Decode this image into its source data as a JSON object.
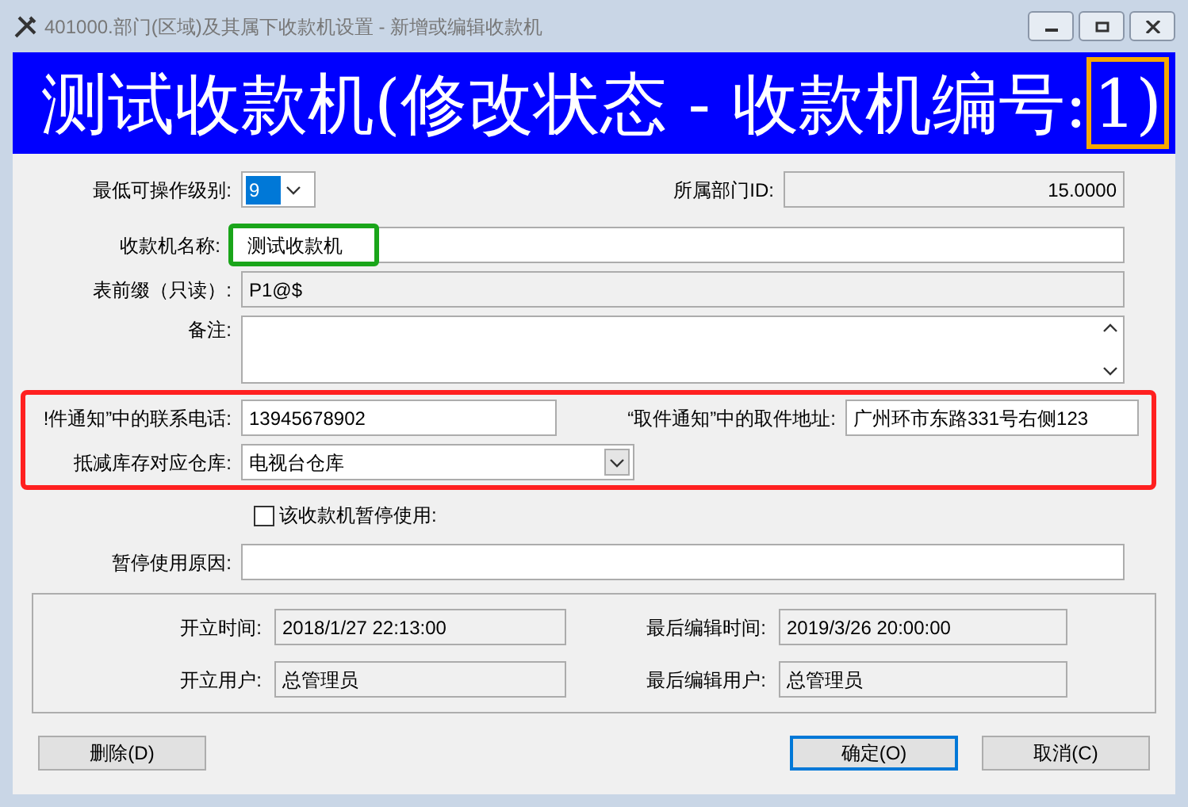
{
  "window": {
    "title": "401000.部门(区域)及其属下收款机设置 - 新增或编辑收款机"
  },
  "banner": {
    "text": "测试收款机(修改状态 - 收款机编号:",
    "number": "1)"
  },
  "fields": {
    "min_level": {
      "label": "最低可操作级别:",
      "value": "9"
    },
    "dept_id": {
      "label": "所属部门ID:",
      "value": "15.0000"
    },
    "name": {
      "label": "收款机名称:",
      "value": "测试收款机"
    },
    "prefix": {
      "label": "表前缀（只读）:",
      "value": "P1@$"
    },
    "remark": {
      "label": "备注:"
    },
    "phone": {
      "label": "!件通知”中的联系电话:",
      "value": "13945678902"
    },
    "address": {
      "label": "“取件通知”中的取件地址:",
      "value": "广州环市东路331号右侧123"
    },
    "warehouse": {
      "label": "抵减库存对应仓库:",
      "value": "电视台仓库"
    },
    "paused": {
      "label": "该收款机暂停使用:",
      "checked": false
    },
    "pause_reason": {
      "label": "暂停使用原因:"
    }
  },
  "info": [
    {
      "label": "开立时间:",
      "value": "2018/1/27 22:13:00"
    },
    {
      "label": "最后编辑时间:",
      "value": "2019/3/26 20:00:00"
    },
    {
      "label": "开立用户:",
      "value": "总管理员"
    },
    {
      "label": "最后编辑用户:",
      "value": "总管理员"
    }
  ],
  "buttons": {
    "delete": "删除(D)",
    "ok": "确定(O)",
    "cancel": "取消(C)"
  }
}
